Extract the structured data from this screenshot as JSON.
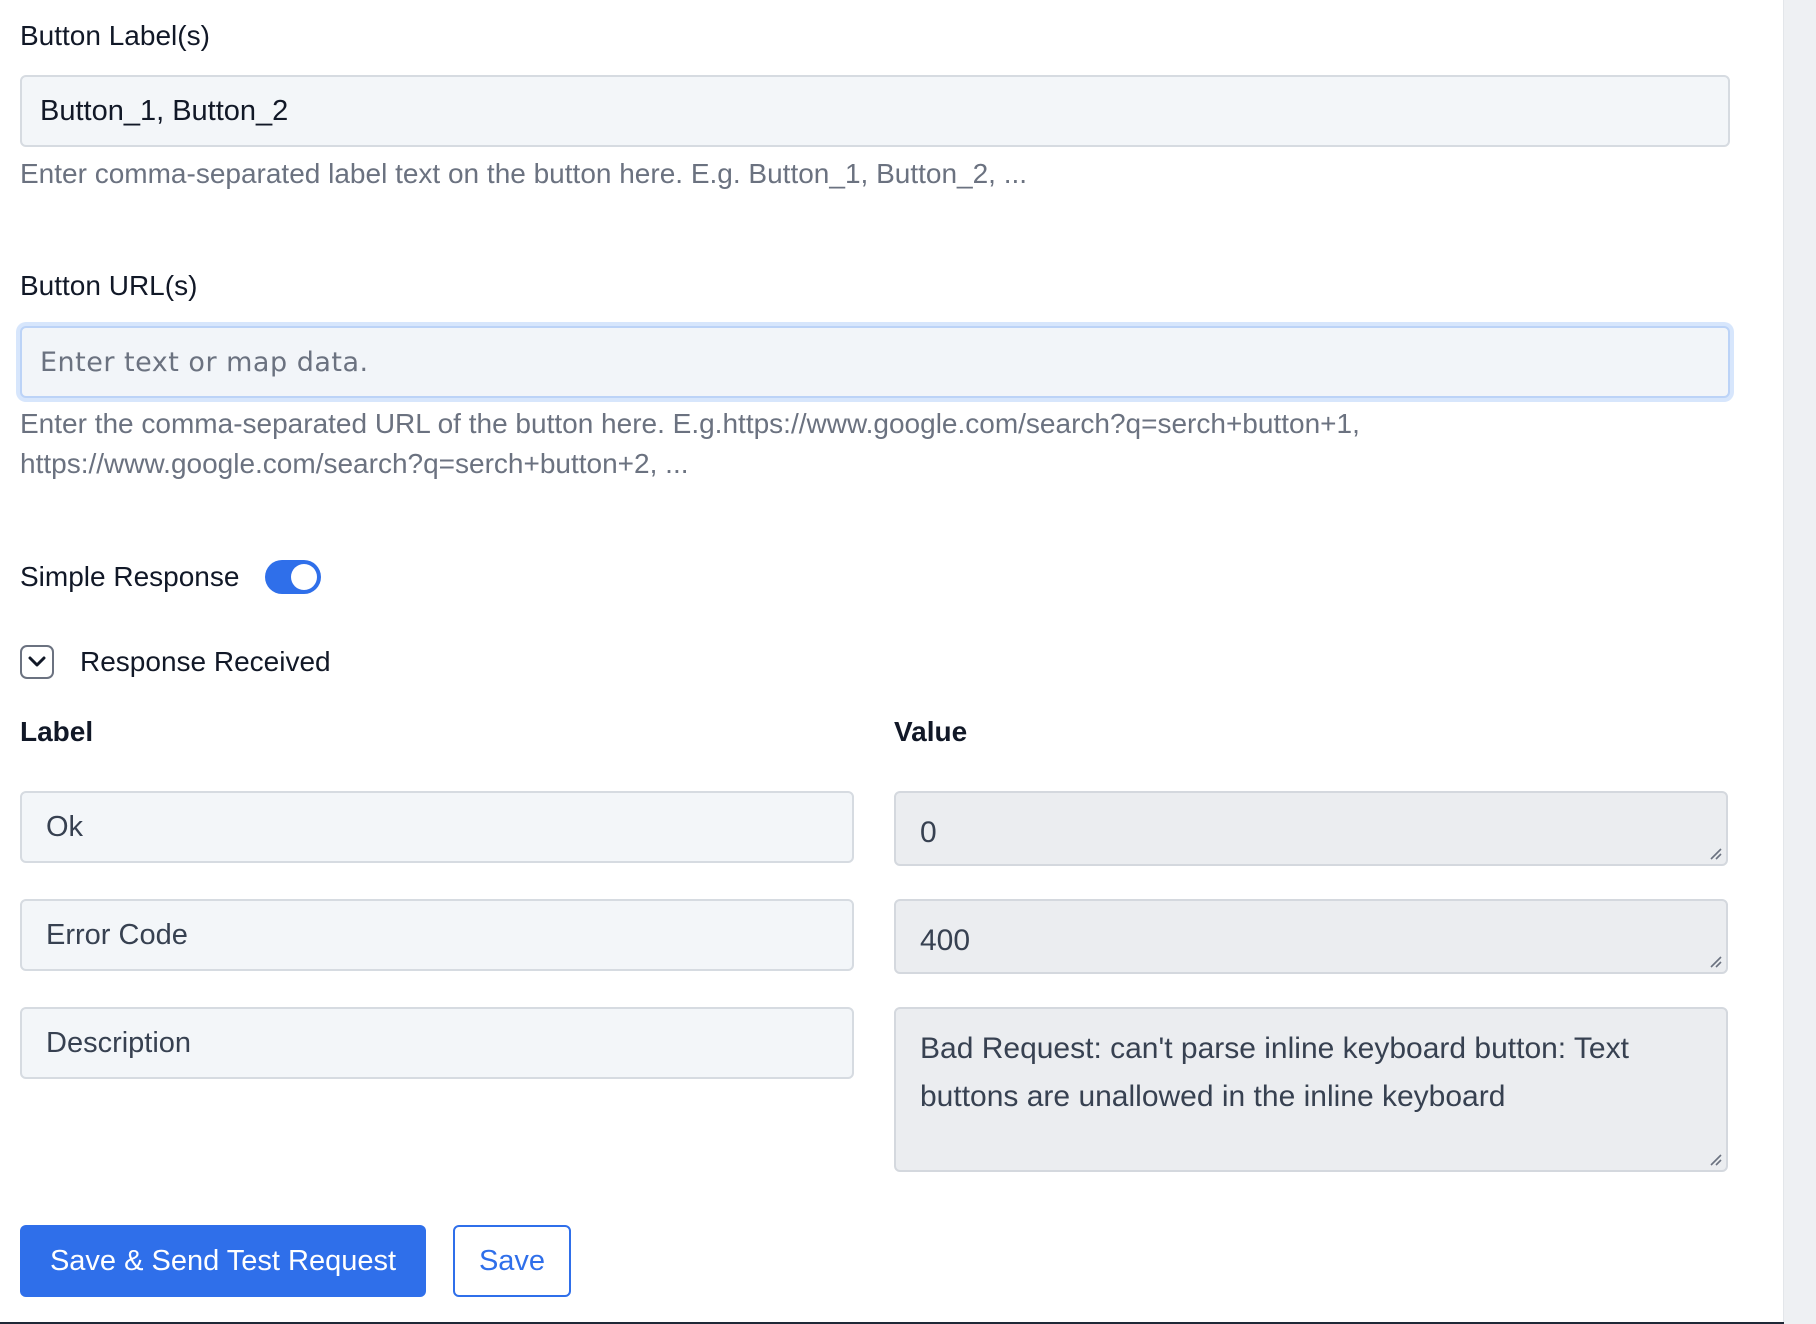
{
  "button_labels": {
    "label": "Button Label(s)",
    "value": "Button_1, Button_2",
    "help": "Enter comma-separated label text on the button here. E.g. Button_1, Button_2, ..."
  },
  "button_urls": {
    "label": "Button URL(s)",
    "placeholder": "Enter text or map data.",
    "help_line1": "Enter the comma-separated URL of the button here. E.g.https://www.google.com/search?q=serch+button+1,",
    "help_line2": "https://www.google.com/search?q=serch+button+2, ..."
  },
  "simple_response": {
    "label": "Simple Response",
    "enabled": true
  },
  "response_received": {
    "label": "Response Received",
    "label_header": "Label",
    "value_header": "Value",
    "rows": [
      {
        "label": "Ok",
        "value": "0"
      },
      {
        "label": "Error Code",
        "value": "400"
      },
      {
        "label": "Description",
        "value": "Bad Request: can't parse inline keyboard button: Text buttons are unallowed in the inline keyboard"
      }
    ]
  },
  "actions": {
    "save_send_label": "Save & Send Test Request",
    "save_label": "Save"
  },
  "colors": {
    "accent": "#2f6fea",
    "help_text": "#6b7280"
  }
}
